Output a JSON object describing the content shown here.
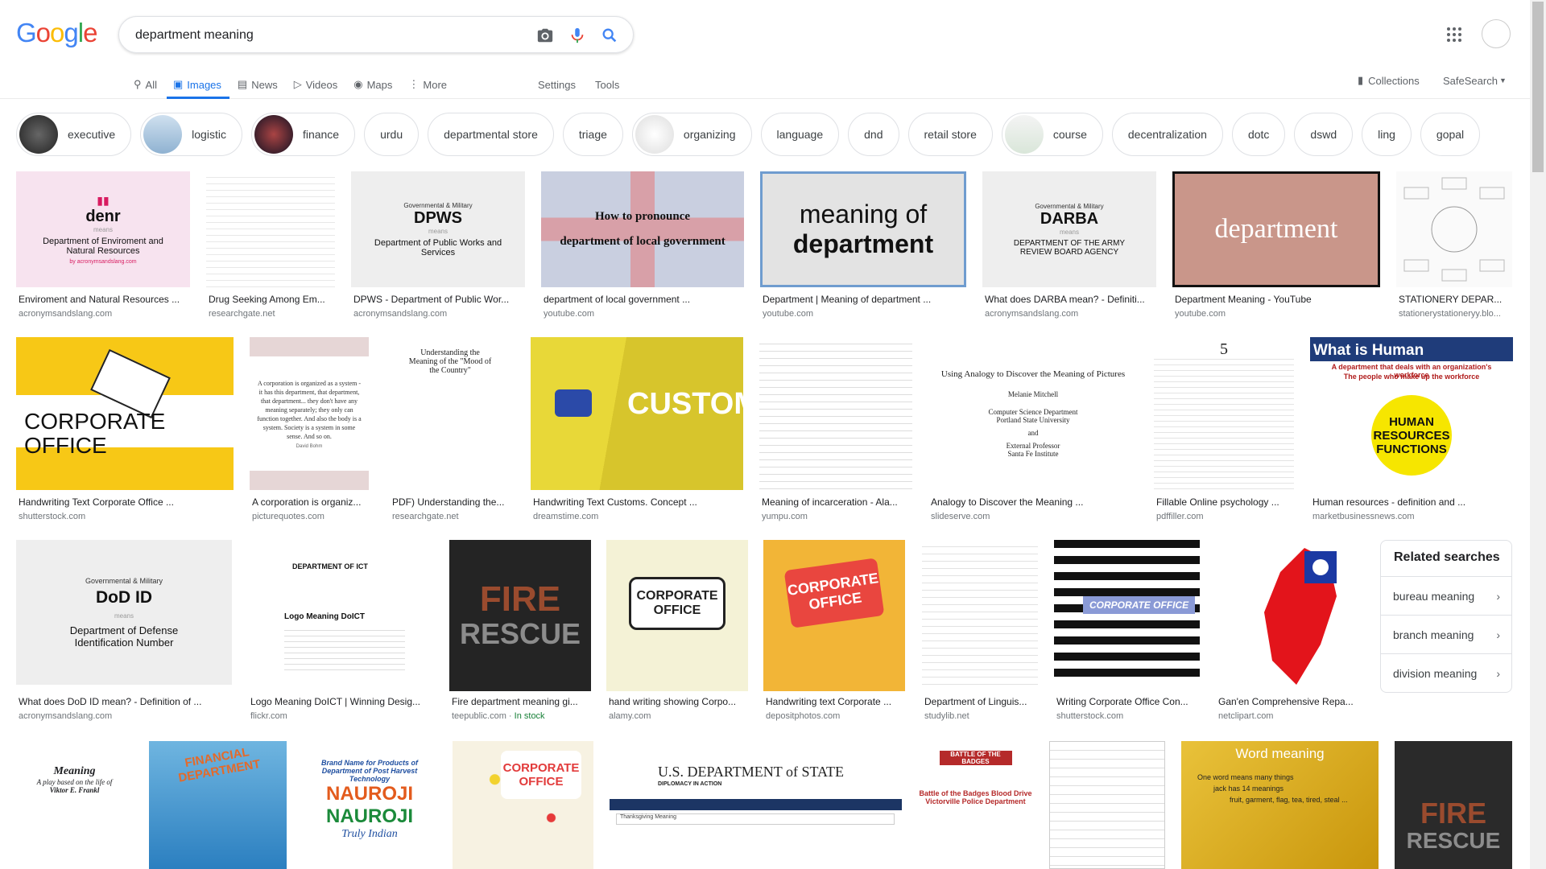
{
  "logo": [
    "G",
    "o",
    "o",
    "g",
    "l",
    "e"
  ],
  "logo_colors": [
    "#4285f4",
    "#ea4335",
    "#fbbc05",
    "#4285f4",
    "#34a853",
    "#ea4335"
  ],
  "search": {
    "value": "department meaning"
  },
  "tabs": [
    {
      "label": "All",
      "icon": "search-icon"
    },
    {
      "label": "Images",
      "icon": "image-icon"
    },
    {
      "label": "News",
      "icon": "news-icon"
    },
    {
      "label": "Videos",
      "icon": "video-icon"
    },
    {
      "label": "Maps",
      "icon": "map-icon"
    },
    {
      "label": "More",
      "icon": "more-vert-icon"
    }
  ],
  "settings_label": "Settings",
  "tools_label": "Tools",
  "collections_label": "Collections",
  "safesearch_label": "SafeSearch",
  "chips": [
    "executive",
    "logistic",
    "finance",
    "urdu",
    "departmental store",
    "triage",
    "organizing",
    "language",
    "dnd",
    "retail store",
    "course",
    "decentralization",
    "dotc",
    "dswd",
    "ling",
    "gopal"
  ],
  "results": [
    {
      "caption": "Enviroment and Natural Resources ...",
      "source": "acronymsandslang.com",
      "img_text": [
        "denr",
        "means",
        "Department of Enviroment and Natural Resources",
        "by acronymsandslang.com"
      ]
    },
    {
      "caption": "Drug Seeking Among Em...",
      "source": "researchgate.net"
    },
    {
      "caption": "DPWS - Department of Public Wor...",
      "source": "acronymsandslang.com",
      "img_text": [
        "Governmental & Military",
        "DPWS",
        "means",
        "Department of Public Works and Services"
      ]
    },
    {
      "caption": "department of local government ...",
      "source": "youtube.com",
      "img_text": [
        "How to pronounce",
        "department of local government"
      ]
    },
    {
      "caption": "Department | Meaning of department ...",
      "source": "youtube.com",
      "img_text": [
        "meaning of",
        "department"
      ]
    },
    {
      "caption": "What does DARBA mean? - Definiti...",
      "source": "acronymsandslang.com",
      "img_text": [
        "Governmental & Military",
        "DARBA",
        "means",
        "DEPARTMENT OF THE ARMY REVIEW BOARD AGENCY"
      ]
    },
    {
      "caption": "Department Meaning - YouTube",
      "source": "youtube.com",
      "img_text": [
        "department"
      ]
    },
    {
      "caption": "STATIONERY DEPAR...",
      "source": "stationerystationeryy.blo..."
    },
    {
      "caption": "Handwriting Text Corporate Office ...",
      "source": "shutterstock.com",
      "img_text": [
        "CORPORATE OFFICE"
      ]
    },
    {
      "caption": "A corporation is organiz...",
      "source": "picturequotes.com",
      "img_text": [
        "A corporation is organized as a system - it has this department, that department, that department... they don't have any meaning separately; they only can function together. And also the body is a system. Society is a system in some sense. And so on.",
        "David Bohm"
      ]
    },
    {
      "caption": "PDF) Understanding the...",
      "source": "researchgate.net",
      "img_text": [
        "Understanding the Meaning of the \"Mood of the Country\""
      ]
    },
    {
      "caption": "Handwriting Text Customs. Concept ...",
      "source": "dreamstime.com",
      "img_text": [
        "CUSTOMS"
      ]
    },
    {
      "caption": "Meaning of incarceration - Ala...",
      "source": "yumpu.com"
    },
    {
      "caption": "Analogy to Discover the Meaning ...",
      "source": "slideserve.com",
      "img_text": [
        "Using Analogy to Discover the Meaning of Pictures",
        "Melanie Mitchell",
        "Computer Science Department",
        "Portland State University",
        "and",
        "External Professor",
        "Santa Fe Institute"
      ]
    },
    {
      "caption": "Fillable Online psychology ...",
      "source": "pdffiller.com",
      "img_text": [
        "5"
      ]
    },
    {
      "caption": "Human resources - definition and ...",
      "source": "marketbusinessnews.com",
      "img_text": [
        "What is Human Resources?",
        "A department that deals with an organization's workforce",
        "The people who make up the workforce",
        "HUMAN RESOURCES FUNCTIONS"
      ]
    },
    {
      "caption": "What does DoD ID mean? - Definition of ...",
      "source": "acronymsandslang.com",
      "img_text": [
        "Governmental & Military",
        "DoD ID",
        "means",
        "Department of Defense Identification Number"
      ]
    },
    {
      "caption": "Logo Meaning DoICT | Winning Desig...",
      "source": "flickr.com",
      "img_text": [
        "DEPARTMENT OF ICT",
        "Logo Meaning DoICT"
      ]
    },
    {
      "caption": "Fire department meaning gi...",
      "source": "teepublic.com",
      "extra": "In stock",
      "img_text": [
        "FIRE",
        "RESCUE"
      ]
    },
    {
      "caption": "hand writing showing Corpo...",
      "source": "alamy.com",
      "img_text": [
        "CORPORATE",
        "OFFICE"
      ]
    },
    {
      "caption": "Handwriting text Corporate ...",
      "source": "depositphotos.com",
      "img_text": [
        "CORPORATE",
        "OFFICE"
      ]
    },
    {
      "caption": "Department of Linguis...",
      "source": "studylib.net"
    },
    {
      "caption": "Writing Corporate Office Con...",
      "source": "shutterstock.com",
      "img_text": [
        "CORPORATE OFFICE"
      ]
    },
    {
      "caption": "Gan'en Comprehensive Repa...",
      "source": "netclipart.com"
    },
    {
      "img_text": [
        "Meaning",
        "A play based on the life of",
        "Viktor E. Frankl"
      ]
    },
    {
      "img_text": [
        "FINANCIAL DEPARTMENT"
      ]
    },
    {
      "img_text": [
        "Brand Name for Products of Department of Post Harvest Technology",
        "NAUROJI",
        "NAUROJI",
        "Truly Indian"
      ]
    },
    {
      "img_text": [
        "CORPORATE",
        "OFFICE"
      ]
    },
    {
      "img_text": [
        "U.S. DEPARTMENT of STATE",
        "DIPLOMACY IN ACTION",
        "Thanksgiving Meaning"
      ]
    },
    {
      "img_text": [
        "BATTLE OF THE BADGES",
        "Battle of the Badges Blood Drive",
        "Victorville Police Department"
      ]
    },
    {},
    {
      "img_text": [
        "Word meaning",
        "One word means many things",
        "jack has 14 meanings",
        "fruit, garment, flag, tea, tired, steal ..."
      ]
    },
    {
      "img_text": [
        "FIRE",
        "RESCUE"
      ]
    }
  ],
  "related": {
    "title": "Related searches",
    "items": [
      "bureau meaning",
      "branch meaning",
      "division meaning"
    ]
  }
}
